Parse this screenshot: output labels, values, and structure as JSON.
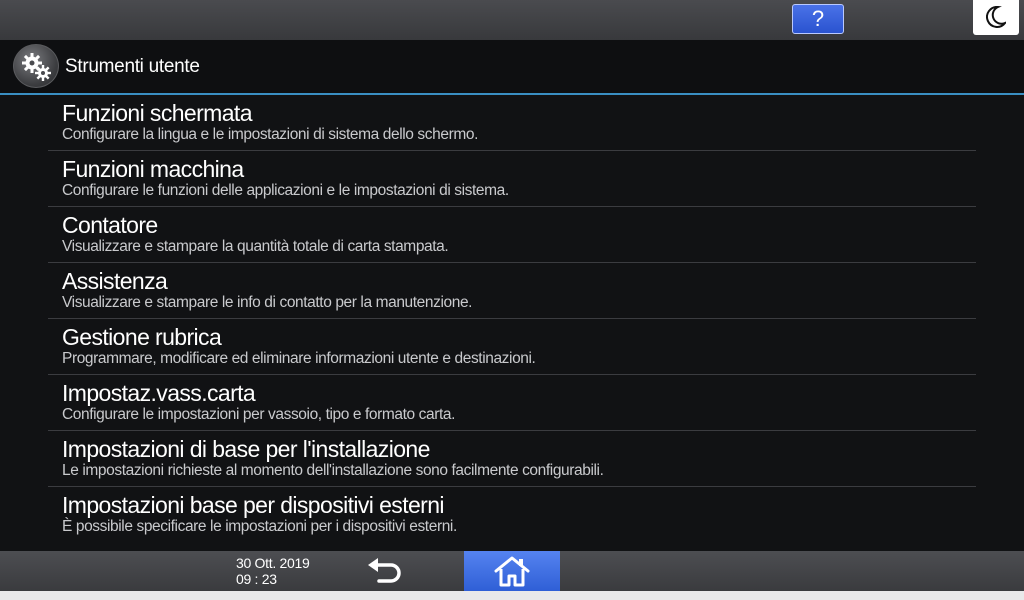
{
  "topbar": {
    "help_label": "?",
    "night_icon": "moon-icon"
  },
  "header": {
    "title": "Strumenti utente",
    "icon": "gears-icon"
  },
  "menu": {
    "items": [
      {
        "title": "Funzioni schermata",
        "description": "Configurare la lingua e le impostazioni di sistema dello schermo."
      },
      {
        "title": "Funzioni macchina",
        "description": "Configurare le funzioni delle applicazioni e le impostazioni di sistema."
      },
      {
        "title": "Contatore",
        "description": "Visualizzare e stampare la quantità totale di carta stampata."
      },
      {
        "title": "Assistenza",
        "description": "Visualizzare e stampare le info di contatto per la manutenzione."
      },
      {
        "title": "Gestione rubrica",
        "description": "Programmare, modificare ed eliminare informazioni utente e destinazioni."
      },
      {
        "title": "Impostaz.vass.carta",
        "description": "Configurare le impostazioni per vassoio, tipo e formato carta."
      },
      {
        "title": "Impostazioni di base per l'installazione",
        "description": "Le impostazioni richieste al momento dell'installazione sono facilmente configurabili."
      },
      {
        "title": "Impostazioni base per dispositivi esterni",
        "description": "È possibile specificare le impostazioni per i dispositivi esterni."
      }
    ]
  },
  "footer": {
    "date": "30 Ott. 2019",
    "time": "09 : 23",
    "back_icon": "back-arrow-icon",
    "home_icon": "home-icon"
  },
  "colors": {
    "accent_line": "#3a8fc3",
    "home_button": "#3f6fe0",
    "help_button": "#3a62dc"
  }
}
